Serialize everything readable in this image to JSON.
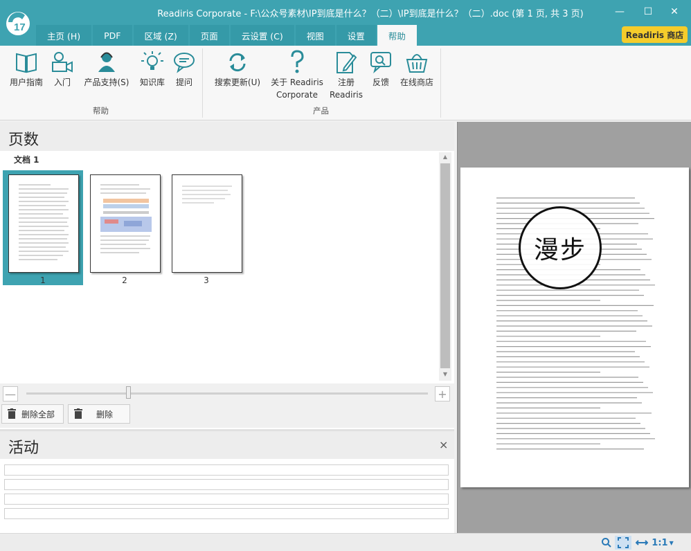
{
  "window": {
    "title": "Readiris Corporate - F:\\公众号素材\\IP到底是什么？（二）\\IP到底是什么？（二）.doc (第 1 页, 共 3 页)",
    "logo_text": "17",
    "minimize": "—",
    "maximize": "☐",
    "close": "✕"
  },
  "tabs": [
    {
      "label": "主页 (H)"
    },
    {
      "label": "PDF"
    },
    {
      "label": "区域 (Z)"
    },
    {
      "label": "页面"
    },
    {
      "label": "云设置 (C)"
    },
    {
      "label": "视图"
    },
    {
      "label": "设置"
    },
    {
      "label": "帮助",
      "active": true
    }
  ],
  "store_button": "Readiris 商店",
  "ribbon": {
    "group_help": {
      "label": "帮助",
      "buttons": [
        {
          "label": "用户指南",
          "icon": "book-icon"
        },
        {
          "label": "入门",
          "icon": "video-camera-icon"
        },
        {
          "label": "产品支持(S)",
          "icon": "support-person-icon"
        },
        {
          "label": "知识库",
          "icon": "lightbulb-icon"
        },
        {
          "label": "提问",
          "icon": "chat-bubble-icon"
        }
      ]
    },
    "group_product": {
      "label": "产品",
      "buttons": [
        {
          "label": "搜索更新(U)",
          "icon": "refresh-icon"
        },
        {
          "label": "关于 Readiris",
          "label2": "Corporate",
          "icon": "question-mark-icon"
        },
        {
          "label": "注册",
          "label2": "Readiris",
          "icon": "register-pen-icon"
        },
        {
          "label": "反馈",
          "icon": "feedback-icon"
        },
        {
          "label": "在线商店",
          "icon": "shopping-basket-icon"
        }
      ]
    }
  },
  "pages_panel": {
    "title": "页数",
    "document_label": "文档 1",
    "thumbnails": [
      {
        "number": "1",
        "selected": true
      },
      {
        "number": "2",
        "selected": false
      },
      {
        "number": "3",
        "selected": false
      }
    ],
    "zoom_minus": "—",
    "zoom_plus": "+",
    "delete_all": "删除全部",
    "delete": "删除"
  },
  "activity_panel": {
    "title": "活动",
    "close": "×"
  },
  "preview": {
    "watermark_text": "漫步"
  },
  "statusbar": {
    "zoom_label": "1:1"
  }
}
